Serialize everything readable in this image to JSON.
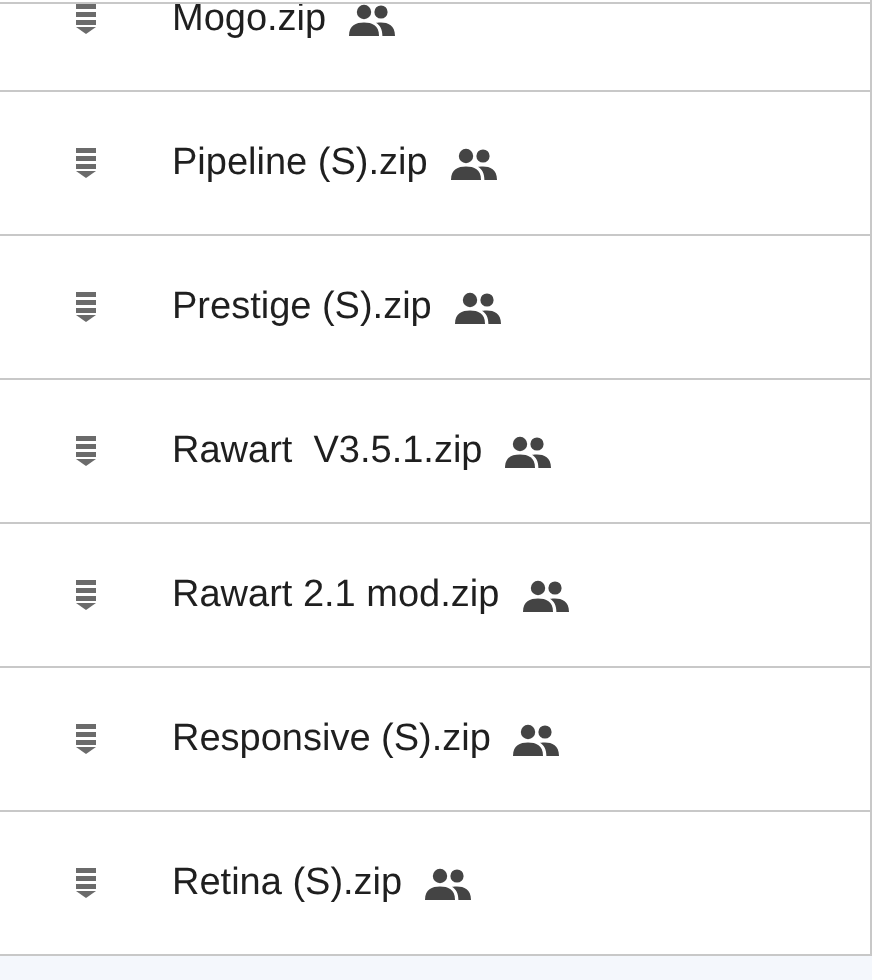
{
  "files": [
    {
      "name": "Mogo.zip",
      "shared": true
    },
    {
      "name": "Pipeline (S).zip",
      "shared": true
    },
    {
      "name": "Prestige (S).zip",
      "shared": true
    },
    {
      "name": "Rawart  V3.5.1.zip",
      "shared": true
    },
    {
      "name": "Rawart 2.1 mod.zip",
      "shared": true
    },
    {
      "name": "Responsive (S).zip",
      "shared": true
    },
    {
      "name": "Retina (S).zip",
      "shared": true
    }
  ]
}
